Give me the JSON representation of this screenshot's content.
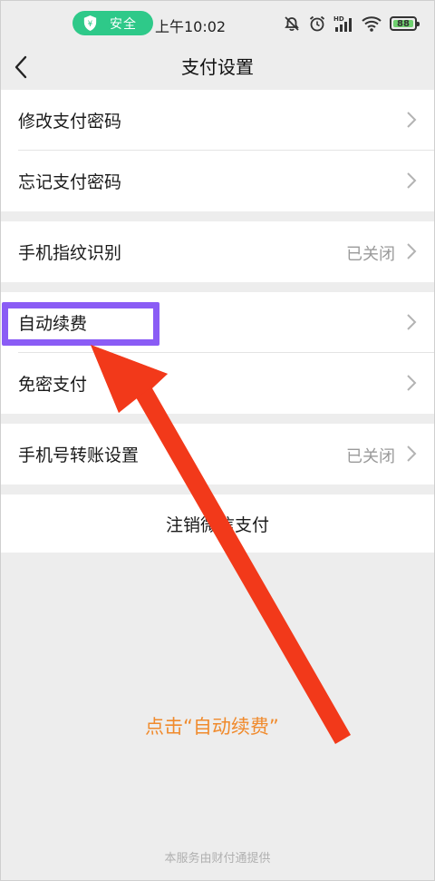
{
  "status_bar": {
    "safe_label": "安全",
    "time": "上午10:02",
    "battery": "88",
    "icons": [
      "shield-icon",
      "mute-icon",
      "alarm-icon",
      "signal-icon",
      "wifi-icon",
      "battery-icon"
    ]
  },
  "nav": {
    "title": "支付设置",
    "back_icon": "chevron-left-icon"
  },
  "groups": [
    {
      "rows": [
        {
          "label": "修改支付密码",
          "value": ""
        },
        {
          "label": "忘记支付密码",
          "value": ""
        }
      ]
    },
    {
      "rows": [
        {
          "label": "手机指纹识别",
          "value": "已关闭"
        }
      ]
    },
    {
      "rows": [
        {
          "label": "自动续费",
          "value": ""
        },
        {
          "label": "免密支付",
          "value": ""
        }
      ]
    },
    {
      "rows": [
        {
          "label": "手机号转账设置",
          "value": "已关闭"
        }
      ]
    },
    {
      "rows": [
        {
          "label": "注销微信支付"
        }
      ]
    }
  ],
  "footer": "本服务由财付通提供",
  "annotation": {
    "caption": "点击“自动续费”",
    "highlight_color": "#8a5cf5",
    "arrow_color": "#f2391a",
    "caption_color": "#f08a2c"
  },
  "colors": {
    "background": "#ededed",
    "safe_green": "#2ec989",
    "value_gray": "#9a9a9a"
  }
}
